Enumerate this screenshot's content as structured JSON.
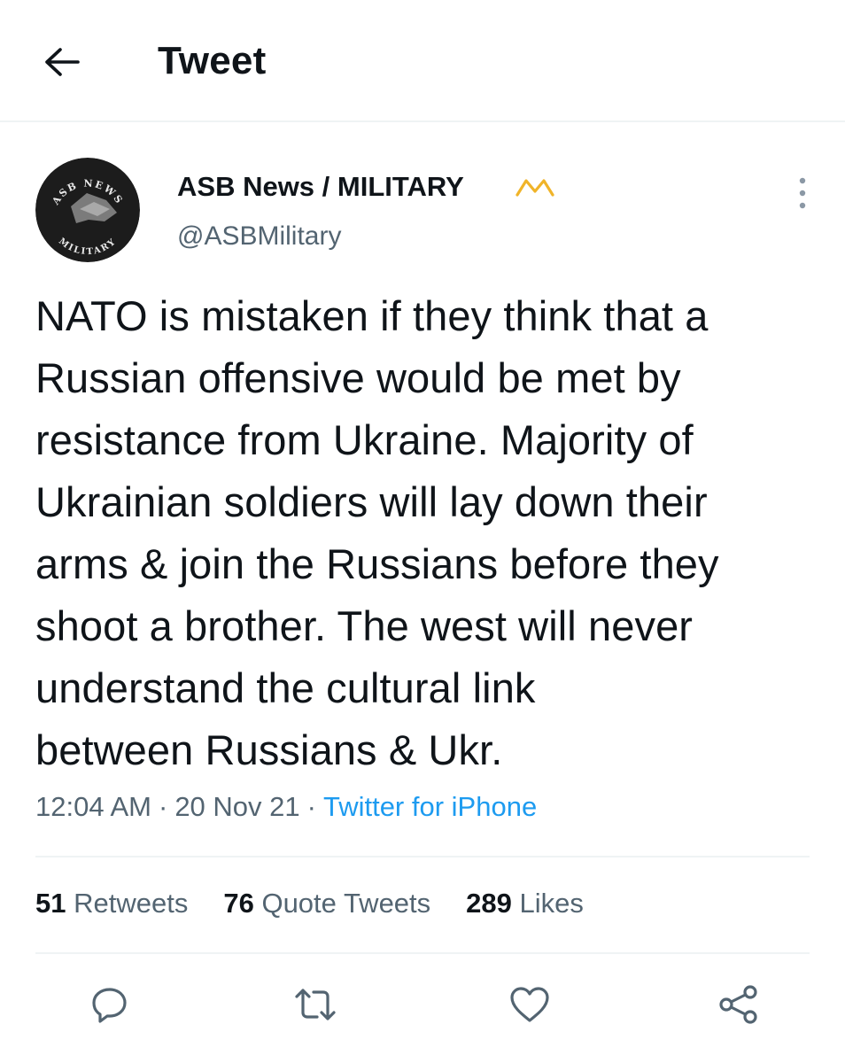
{
  "header": {
    "title": "Tweet",
    "back_icon": "arrow-left-icon"
  },
  "author": {
    "display_name": "ASB News / MILITARY",
    "handle": "@ASBMilitary",
    "avatar_text_top": "ASB NEWS",
    "avatar_text_bottom": "MILITARY",
    "badge_icon": "crown-icon",
    "badge_color": "#f0b429"
  },
  "tweet": {
    "lines": [
      "NATO is mistaken if they think that a",
      "Russian offensive would be met by",
      "resistance from Ukraine. Majority of",
      "Ukrainian soldiers will lay down their",
      "arms & join the Russians before they",
      "shoot a brother. The west will never",
      "understand the cultural link",
      "between Russians & Ukr."
    ],
    "time": "12:04 AM",
    "date": "20 Nov 21",
    "separator": "·",
    "source": "Twitter for iPhone"
  },
  "stats": {
    "retweets": {
      "count": "51",
      "label": "Retweets"
    },
    "quotes": {
      "count": "76",
      "label": "Quote Tweets"
    },
    "likes": {
      "count": "289",
      "label": "Likes"
    }
  },
  "actions": [
    "reply-icon",
    "retweet-icon",
    "like-icon",
    "share-icon"
  ],
  "colors": {
    "text": "#0f1419",
    "secondary": "#536471",
    "link": "#1d9bf0",
    "divider": "#eff3f4"
  }
}
